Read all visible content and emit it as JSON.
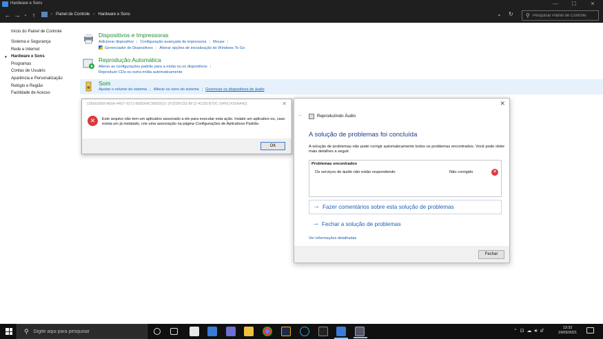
{
  "window": {
    "title": "Hardware e Sons",
    "controls": {
      "minimize": "—",
      "maximize": "☐",
      "close": "✕"
    }
  },
  "addressbar": {
    "breadcrumbs": [
      "Painel de Controle",
      "Hardware e Sons"
    ],
    "search_placeholder": "Pesquisar Painel de Controle"
  },
  "leftnav": {
    "home": "Início do Painel de Controle",
    "items": [
      "Sistema e Segurança",
      "Rede e Internet",
      "Hardware e Sons",
      "Programas",
      "Contas de Usuário",
      "Aparência e Personalização",
      "Relógio e Região",
      "Facilidade de Acesso"
    ],
    "current": "Hardware e Sons"
  },
  "categories": {
    "devices": {
      "title": "Dispositivos e Impressoras",
      "links_row1": [
        "Adicionar dispositivo",
        "Configuração avançada de impressora",
        "Mouse"
      ],
      "links_row2": [
        "Gerenciador de Dispositivos",
        "Alterar opções de inicialização do Windows To Go"
      ]
    },
    "autoplay": {
      "title": "Reprodução Automática",
      "links_row1": [
        "Alterar as configurações padrão para a mídia ou os dispositivos"
      ],
      "links_row2": [
        "Reproduzir CDs ou outra mídia automaticamente"
      ]
    },
    "sound": {
      "title": "Som",
      "links_row1": [
        "Ajustar o volume do sistema",
        "Alterar os sons do sistema",
        "Gerenciar os dispositivos de áudio"
      ]
    }
  },
  "error_dialog": {
    "title": "::{26EE0668-A00A-44D7-9371-BEB064C98683}\\2\\::{F2DDFC82-8F12-4CDD-B7DC-D4FE1425AA4D}",
    "message": "Este arquivo não tem um aplicativo associado a ele para executar esta ação. Instale um aplicativo ou, caso exista um já instalado, crie uma associação na página Configurações de Aplicativos Padrão.",
    "ok_label": "OK"
  },
  "troubleshooter": {
    "app_title": "Reproduzindo Áudio",
    "heading": "A solução de problemas foi concluída",
    "description": "A solução de problemas não pode corrigir automaticamente todos os problemas encontrados. Você pode obter mais detalhes a seguir.",
    "problems_header": "Problemas encontrados",
    "problem_name": "Os serviços de áudio não estão respondendo",
    "problem_status": "Não corrigido",
    "action_feedback": "Fazer comentários sobre esta solução de problemas",
    "action_close": "Fechar a solução de problemas",
    "details_link": "Ver informações detalhadas",
    "close_button": "Fechar"
  },
  "taskbar": {
    "search_placeholder": "Digite aqui para pesquisar",
    "clock_time": "13:32",
    "clock_date": "19/03/2021"
  },
  "colors": {
    "category_title": "#1e8e2e",
    "link": "#1a5fb4",
    "heading": "#1a3f8a",
    "error_red": "#d93a3a"
  }
}
